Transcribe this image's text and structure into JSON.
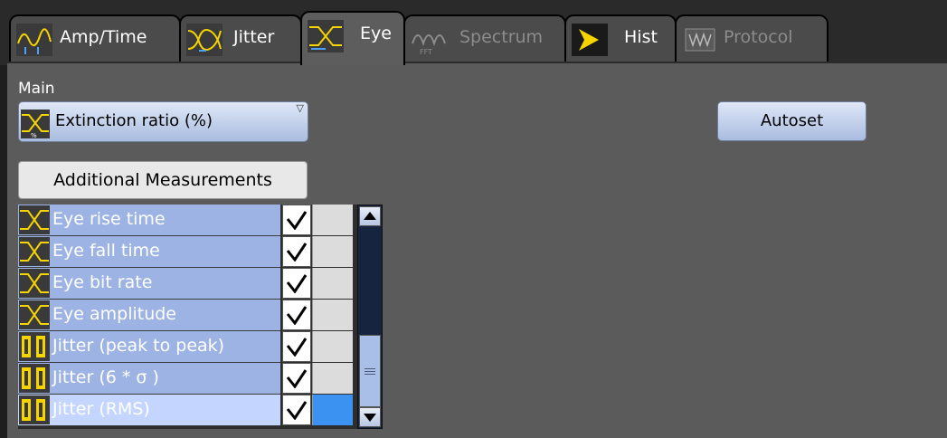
{
  "tabs": [
    {
      "label": "Amp/Time",
      "icon": "amp-time-icon",
      "active": false,
      "disabled": false
    },
    {
      "label": "Jitter",
      "icon": "jitter-icon",
      "active": false,
      "disabled": false
    },
    {
      "label": "Eye",
      "icon": "eye-icon",
      "active": true,
      "disabled": false
    },
    {
      "label": "Spectrum",
      "icon": "spectrum-fft-icon",
      "active": false,
      "disabled": true
    },
    {
      "label": "Hist",
      "icon": "histogram-flag-icon",
      "active": false,
      "disabled": false
    },
    {
      "label": "Protocol",
      "icon": "protocol-icon",
      "active": false,
      "disabled": true
    }
  ],
  "main": {
    "label": "Main",
    "selected_measurement": "Extinction ratio (%)",
    "autoset_label": "Autoset",
    "additional_label": "Additional Measurements"
  },
  "measurements": [
    {
      "label": "Eye rise time",
      "icon": "eye-icon",
      "checked": true
    },
    {
      "label": "Eye fall time",
      "icon": "eye-icon",
      "checked": true
    },
    {
      "label": "Eye bit rate",
      "icon": "eye-icon",
      "checked": true
    },
    {
      "label": "Eye amplitude",
      "icon": "eye-icon",
      "checked": true
    },
    {
      "label": "Jitter (peak to peak)",
      "icon": "jitter-measure-icon",
      "checked": true
    },
    {
      "label": "Jitter (6 * σ )",
      "icon": "jitter-measure-icon",
      "checked": true
    },
    {
      "label": "Jitter (RMS)",
      "icon": "jitter-measure-icon",
      "checked": true,
      "selected": true
    }
  ],
  "colors": {
    "list_row": "#9db3e4",
    "list_row_selected": "#c4d6ff",
    "selection_accent": "#3c92f0",
    "icon_yellow": "#f5d400",
    "icon_blue": "#4e9fff"
  }
}
